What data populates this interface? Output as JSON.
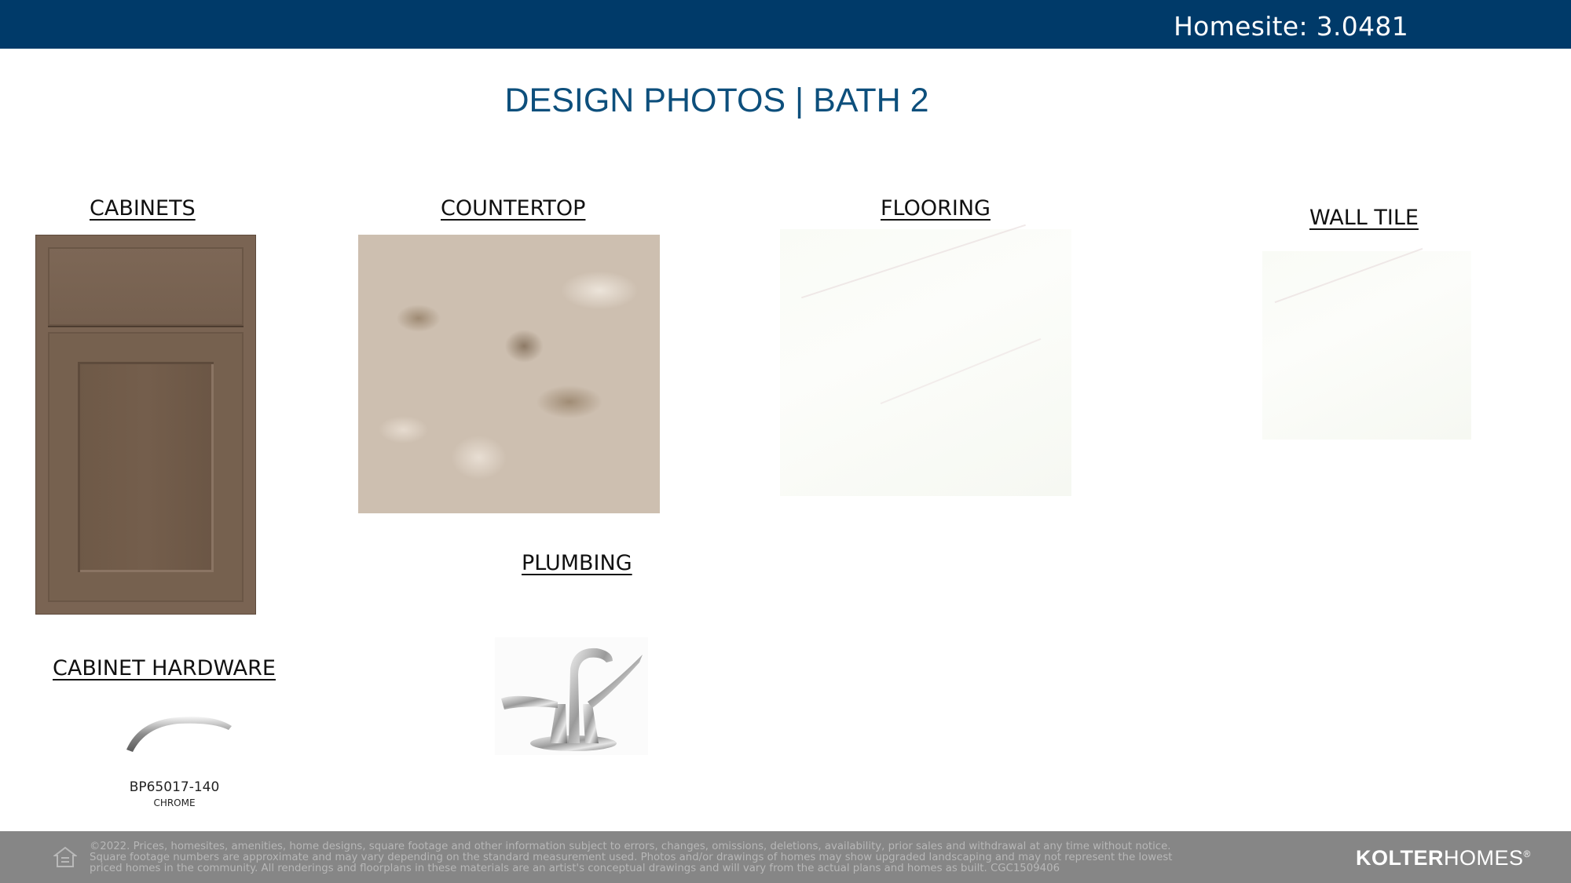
{
  "header": {
    "homesite": "Homesite: 3.0481"
  },
  "title": "DESIGN PHOTOS | BATH 2",
  "sections": {
    "cabinets": "CABINETS",
    "countertop": "COUNTERTOP",
    "flooring": "FLOORING",
    "wall_tile": "WALL TILE",
    "plumbing": "PLUMBING",
    "cabinet_hardware": "CABINET HARDWARE"
  },
  "hardware": {
    "part_number": "BP65017-140",
    "finish": "CHROME"
  },
  "footer": {
    "disclaimer": [
      "©2022. Prices, homesites, amenities, home designs, square footage and other information subject to errors, changes, omissions, deletions, availability, prior sales and withdrawal at any time without notice.",
      "Square footage numbers are approximate and may vary depending on the standard measurement used. Photos and/or drawings of homes may show upgraded landscaping and may not represent the lowest",
      "priced homes in the community. All renderings and floorplans in these materials are an artist's conceptual drawings and will vary from the actual plans and homes as built. CGC1509406"
    ],
    "logo_bold": "KOLTER",
    "logo_regular": "HOMES",
    "logo_mark": "®"
  },
  "colors": {
    "header_bg": "#003a69",
    "title": "#0d4f7c",
    "footer_bg": "#868686"
  },
  "icons": {
    "equal_housing": "equal-housing-icon"
  }
}
